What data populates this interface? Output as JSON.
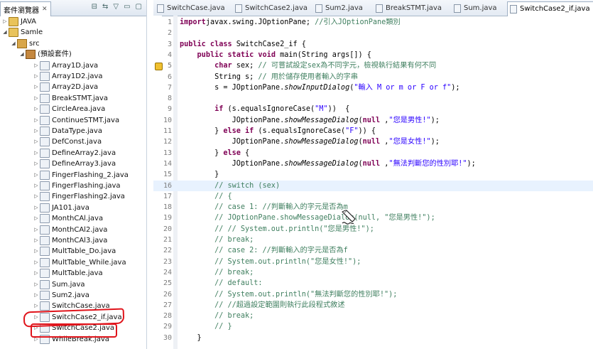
{
  "explorer": {
    "title": "套件瀏覽器",
    "close": "✕",
    "tree": [
      {
        "label": "JAVA",
        "indent": 0,
        "icon": "proj",
        "arrow": "▷"
      },
      {
        "label": "Samle",
        "indent": 0,
        "icon": "proj",
        "arrow": "◢"
      },
      {
        "label": "src",
        "indent": 1,
        "icon": "src",
        "arrow": "◢"
      },
      {
        "label": "(預設套件)",
        "indent": 2,
        "icon": "pkg",
        "arrow": "◢"
      },
      {
        "label": "Array1D.java",
        "indent": 3,
        "icon": "java",
        "arrow": "▷"
      },
      {
        "label": "Array1D2.java",
        "indent": 3,
        "icon": "java",
        "arrow": "▷"
      },
      {
        "label": "Array2D.java",
        "indent": 3,
        "icon": "java",
        "arrow": "▷"
      },
      {
        "label": "BreakSTMT.java",
        "indent": 3,
        "icon": "java",
        "arrow": "▷"
      },
      {
        "label": "CircleArea.java",
        "indent": 3,
        "icon": "java",
        "arrow": "▷"
      },
      {
        "label": "ContinueSTMT.java",
        "indent": 3,
        "icon": "java",
        "arrow": "▷"
      },
      {
        "label": "DataType.java",
        "indent": 3,
        "icon": "java",
        "arrow": "▷"
      },
      {
        "label": "DefConst.java",
        "indent": 3,
        "icon": "java",
        "arrow": "▷"
      },
      {
        "label": "DefineArray2.java",
        "indent": 3,
        "icon": "java",
        "arrow": "▷"
      },
      {
        "label": "DefineArray3.java",
        "indent": 3,
        "icon": "java",
        "arrow": "▷"
      },
      {
        "label": "FingerFlashing_2.java",
        "indent": 3,
        "icon": "java",
        "arrow": "▷"
      },
      {
        "label": "FingerFlashing.java",
        "indent": 3,
        "icon": "java",
        "arrow": "▷"
      },
      {
        "label": "FingerFlashing2.java",
        "indent": 3,
        "icon": "java",
        "arrow": "▷"
      },
      {
        "label": "JA101.java",
        "indent": 3,
        "icon": "java",
        "arrow": "▷"
      },
      {
        "label": "MonthCAl.java",
        "indent": 3,
        "icon": "java",
        "arrow": "▷"
      },
      {
        "label": "MonthCAl2.java",
        "indent": 3,
        "icon": "java",
        "arrow": "▷"
      },
      {
        "label": "MonthCAl3.java",
        "indent": 3,
        "icon": "java",
        "arrow": "▷"
      },
      {
        "label": "MultTable_Do.java",
        "indent": 3,
        "icon": "java",
        "arrow": "▷"
      },
      {
        "label": "MultTable_While.java",
        "indent": 3,
        "icon": "java",
        "arrow": "▷"
      },
      {
        "label": "MultTable.java",
        "indent": 3,
        "icon": "java",
        "arrow": "▷"
      },
      {
        "label": "Sum.java",
        "indent": 3,
        "icon": "java",
        "arrow": "▷"
      },
      {
        "label": "Sum2.java",
        "indent": 3,
        "icon": "java",
        "arrow": "▷"
      },
      {
        "label": "SwitchCase.java",
        "indent": 3,
        "icon": "java",
        "arrow": "▷"
      },
      {
        "label": "SwitchCase2_if.java",
        "indent": 3,
        "icon": "java",
        "arrow": "▷"
      },
      {
        "label": "SwitchCase2.java",
        "indent": 3,
        "icon": "java",
        "arrow": "▷"
      },
      {
        "label": "WhileBreak.java",
        "indent": 3,
        "icon": "java",
        "arrow": "▷"
      }
    ]
  },
  "tabs": [
    {
      "label": "SwitchCase.java",
      "active": false
    },
    {
      "label": "SwitchCase2.java",
      "active": false
    },
    {
      "label": "Sum2.java",
      "active": false
    },
    {
      "label": "BreakSTMT.java",
      "active": false
    },
    {
      "label": "Sum.java",
      "active": false
    },
    {
      "label": "SwitchCase2_if.java",
      "active": true,
      "close": "✕"
    }
  ],
  "code": [
    {
      "n": "1",
      "parts": [
        [
          "kw",
          "import"
        ],
        [
          "",
          "javax.swing.JOptionPane; "
        ],
        [
          "cm",
          "//引入JOptionPane類別"
        ]
      ]
    },
    {
      "n": "2",
      "parts": []
    },
    {
      "n": "3",
      "parts": [
        [
          "kw",
          "public class "
        ],
        [
          "",
          "SwitchCase2_if {"
        ]
      ]
    },
    {
      "n": "4",
      "parts": [
        [
          "",
          "    "
        ],
        [
          "kw",
          "public static void "
        ],
        [
          "",
          "main(String args[]) {"
        ]
      ]
    },
    {
      "n": "5",
      "parts": [
        [
          "",
          "        "
        ],
        [
          "kw",
          "char "
        ],
        [
          "",
          "sex; "
        ],
        [
          "cm",
          "// 可嘗試設定sex為不同字元，檢視執行結果有何不同"
        ]
      ],
      "warn": true
    },
    {
      "n": "6",
      "parts": [
        [
          "",
          "        String s; "
        ],
        [
          "cm",
          "// 用於儲存使用者輸入的字串"
        ]
      ]
    },
    {
      "n": "7",
      "parts": [
        [
          "",
          "        s = JOptionPane."
        ],
        [
          "it",
          "showInputDialog"
        ],
        [
          "",
          "("
        ],
        [
          "st",
          "\"輸入 M or m or F or f\""
        ],
        [
          "",
          ");"
        ]
      ]
    },
    {
      "n": "8",
      "parts": []
    },
    {
      "n": "9",
      "parts": [
        [
          "",
          "        "
        ],
        [
          "kw",
          "if "
        ],
        [
          "",
          "(s.equalsIgnoreCase("
        ],
        [
          "st",
          "\"M\""
        ],
        [
          "",
          "))  {"
        ]
      ]
    },
    {
      "n": "10",
      "parts": [
        [
          "",
          "            JOptionPane."
        ],
        [
          "it",
          "showMessageDialog"
        ],
        [
          "",
          "("
        ],
        [
          "kw",
          "null"
        ],
        [
          "",
          " ,"
        ],
        [
          "st",
          "\"您是男性!\""
        ],
        [
          "",
          ");"
        ]
      ]
    },
    {
      "n": "11",
      "parts": [
        [
          "",
          "        } "
        ],
        [
          "kw",
          "else if "
        ],
        [
          "",
          "(s.equalsIgnoreCase("
        ],
        [
          "st",
          "\"F\""
        ],
        [
          "",
          ")) {"
        ]
      ]
    },
    {
      "n": "12",
      "parts": [
        [
          "",
          "            JOptionPane."
        ],
        [
          "it",
          "showMessageDialog"
        ],
        [
          "",
          "("
        ],
        [
          "kw",
          "null"
        ],
        [
          "",
          " ,"
        ],
        [
          "st",
          "\"您是女性!\""
        ],
        [
          "",
          ");"
        ]
      ]
    },
    {
      "n": "13",
      "parts": [
        [
          "",
          "        } "
        ],
        [
          "kw",
          "else "
        ],
        [
          "",
          "{"
        ]
      ]
    },
    {
      "n": "14",
      "parts": [
        [
          "",
          "            JOptionPane."
        ],
        [
          "it",
          "showMessageDialog"
        ],
        [
          "",
          "("
        ],
        [
          "kw",
          "null"
        ],
        [
          "",
          " ,"
        ],
        [
          "st",
          "\"無法判斷您的性別耶!\""
        ],
        [
          "",
          ");"
        ]
      ]
    },
    {
      "n": "15",
      "parts": [
        [
          "",
          "        }"
        ]
      ]
    },
    {
      "n": "16",
      "parts": [
        [
          "",
          "        "
        ],
        [
          "cm",
          "// switch (sex)"
        ]
      ],
      "cur": true
    },
    {
      "n": "17",
      "parts": [
        [
          "",
          "        "
        ],
        [
          "cm",
          "// {"
        ]
      ]
    },
    {
      "n": "18",
      "parts": [
        [
          "",
          "        "
        ],
        [
          "cm",
          "// case 1: //判斷輸入的字元是否為m"
        ]
      ]
    },
    {
      "n": "19",
      "parts": [
        [
          "",
          "        "
        ],
        [
          "cm",
          "// JOptionPane.showMessageDialog(null, \"您是男性!\");"
        ]
      ]
    },
    {
      "n": "20",
      "parts": [
        [
          "",
          "        "
        ],
        [
          "cm",
          "// // System.out.println(\"您是男性!\");"
        ]
      ]
    },
    {
      "n": "21",
      "parts": [
        [
          "",
          "        "
        ],
        [
          "cm",
          "// break;"
        ]
      ]
    },
    {
      "n": "22",
      "parts": [
        [
          "",
          "        "
        ],
        [
          "cm",
          "// case 2: //判斷輸入的字元是否為f"
        ]
      ]
    },
    {
      "n": "23",
      "parts": [
        [
          "",
          "        "
        ],
        [
          "cm",
          "// System.out.println(\"您是女性!\");"
        ]
      ]
    },
    {
      "n": "24",
      "parts": [
        [
          "",
          "        "
        ],
        [
          "cm",
          "// break;"
        ]
      ]
    },
    {
      "n": "25",
      "parts": [
        [
          "",
          "        "
        ],
        [
          "cm",
          "// default:"
        ]
      ]
    },
    {
      "n": "26",
      "parts": [
        [
          "",
          "        "
        ],
        [
          "cm",
          "// System.out.println(\"無法判斷您的性別耶!\");"
        ]
      ]
    },
    {
      "n": "27",
      "parts": [
        [
          "",
          "        "
        ],
        [
          "cm",
          "// //超過設定範圍則執行此段程式敘述"
        ]
      ]
    },
    {
      "n": "28",
      "parts": [
        [
          "",
          "        "
        ],
        [
          "cm",
          "// break;"
        ]
      ]
    },
    {
      "n": "29",
      "parts": [
        [
          "",
          "        "
        ],
        [
          "cm",
          "// }"
        ]
      ]
    },
    {
      "n": "30",
      "parts": [
        [
          "",
          "    }"
        ]
      ]
    }
  ]
}
